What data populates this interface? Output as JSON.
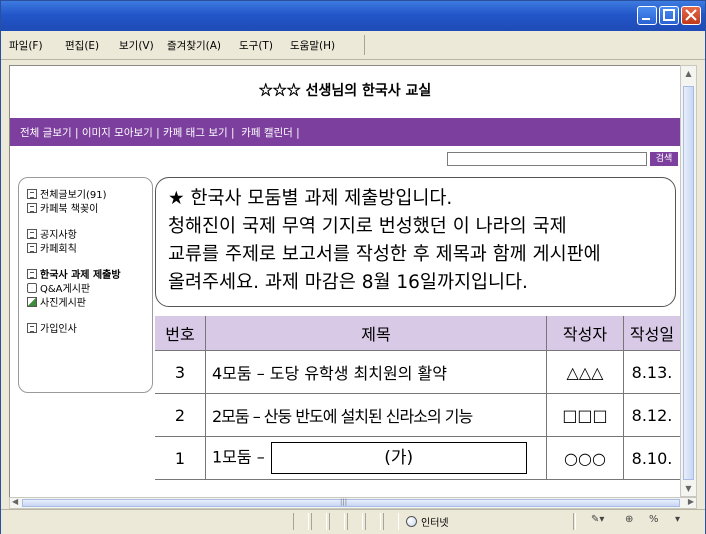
{
  "window": {
    "buttons": {
      "minimize": "minimize-button",
      "maximize": "maximize-button",
      "close": "close-button"
    }
  },
  "menubar": {
    "items": [
      {
        "label": "파일(F)"
      },
      {
        "label": "편집(E)"
      },
      {
        "label": "보기(V)"
      },
      {
        "label": "즐겨찾기(A)"
      },
      {
        "label": "도구(T)"
      },
      {
        "label": "도움말(H)"
      }
    ]
  },
  "page": {
    "title": "☆☆☆ 선생님의 한국사 교실",
    "nav": "전체 글보기 | 이미지 모아보기 | 카페 태그 보기 |  카페 캘린더 |",
    "search": {
      "value": "",
      "button": "검색"
    }
  },
  "sidebar": {
    "groups": [
      {
        "items": [
          {
            "label": "전체글보기(91)",
            "icon": "list-icon"
          },
          {
            "label": "카페북 책꽂이",
            "icon": "list-icon"
          }
        ]
      },
      {
        "items": [
          {
            "label": "공지사항",
            "icon": "list-icon"
          },
          {
            "label": "카페회칙",
            "icon": "list-icon"
          }
        ]
      },
      {
        "items": [
          {
            "label": "한국사 과제 제출방",
            "icon": "list-icon",
            "bold": true
          },
          {
            "label": "Q&A게시판",
            "icon": "chat-icon"
          },
          {
            "label": "사진게시판",
            "icon": "photo-icon"
          }
        ]
      },
      {
        "items": [
          {
            "label": "가입인사",
            "icon": "list-icon"
          }
        ]
      }
    ]
  },
  "notice": {
    "lines": [
      "★ 한국사 모둠별 과제 제출방입니다.",
      "   청해진이 국제 무역 기지로 번성했던 이 나라의 국제",
      "교류를 주제로 보고서를 작성한 후 제목과 함께 게시판에",
      "올려주세요. 과제 마감은 8월 16일까지입니다."
    ]
  },
  "board": {
    "headers": {
      "num": "번호",
      "title": "제목",
      "author": "작성자",
      "date": "작성일"
    },
    "rows": [
      {
        "num": "3",
        "title": "4모둠 – 도당 유학생 최치원의 활약",
        "author": "△△△",
        "date": "8.13."
      },
      {
        "num": "2",
        "title": "2모둠 – 산둥 반도에 설치된 신라소의 기능",
        "author": "□□□",
        "date": "8.12."
      },
      {
        "num": "1",
        "title": "1모둠 –",
        "blank": "(가)",
        "author": "○○○",
        "date": "8.10."
      }
    ]
  },
  "statusbar": {
    "zone": "인터넷",
    "zoom_label": "%"
  }
}
